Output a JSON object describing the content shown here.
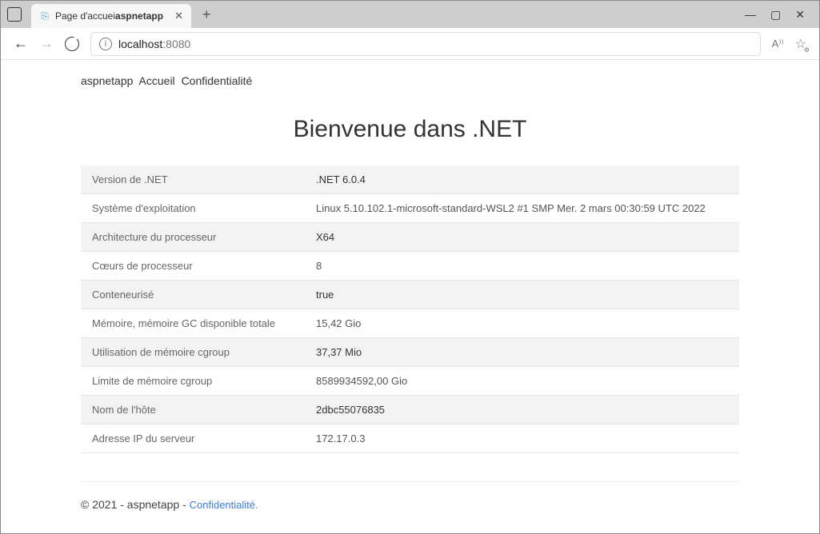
{
  "window": {
    "tab_title_a": "Page d'accuei",
    "tab_title_b": "aspnetapp",
    "url_host": "localhost",
    "url_port": ":8080",
    "read_aloud": "A⁾⁾"
  },
  "nav": {
    "brand": "aspnetapp",
    "link1": "Accueil",
    "link2": "Confidentialité"
  },
  "hero": "Bienvenue dans .NET",
  "rows": [
    {
      "k": "Version de .NET",
      "v": ".NET 6.0.4"
    },
    {
      "k": "Système d'exploitation",
      "v": "Linux 5.10.102.1-microsoft-standard-WSL2 #1 SMP Mer. 2 mars 00:30:59 UTC 2022"
    },
    {
      "k": "Architecture du processeur",
      "v": "X64"
    },
    {
      "k": "Cœurs de processeur",
      "v": "8"
    },
    {
      "k": "Conteneurisé",
      "v": "true"
    },
    {
      "k": "Mémoire, mémoire GC disponible totale",
      "v": "15,42 Gio"
    },
    {
      "k": "Utilisation de mémoire cgroup",
      "v": "37,37 Mio"
    },
    {
      "k": "Limite de mémoire cgroup",
      "v": "8589934592,00 Gio"
    },
    {
      "k": "Nom de l'hôte",
      "v": "2dbc55076835"
    },
    {
      "k": "Adresse IP du serveur",
      "v": "172.17.0.3"
    }
  ],
  "footer": {
    "text": "© 2021 - aspnetapp - ",
    "link": "Confidentialité."
  }
}
